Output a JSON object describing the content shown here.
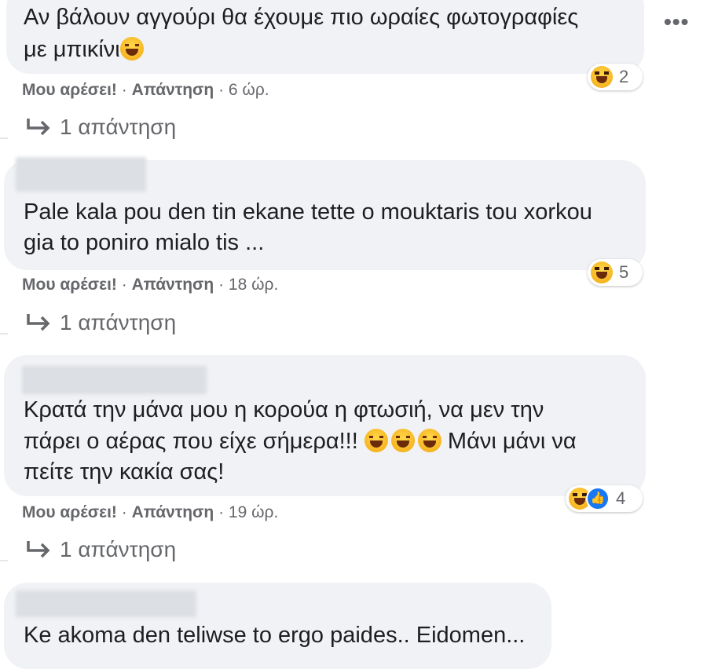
{
  "more_label": "•••",
  "comments": [
    {
      "lines": [
        "Αν βάλουν αγγούρι θα έχουμε πιο ωραίες φωτογραφίες",
        "με μπικίνι"
      ],
      "inline_emoji_count": 1,
      "reaction_count": "2",
      "reactions": [
        "haha-icon"
      ],
      "like_label": "Μου αρέσει!",
      "reply_label": "Απάντηση",
      "time": "6 ώρ.",
      "replies_label": "1 απάντηση"
    },
    {
      "lines": [
        "Pale kala pou den tin ekane tette o mouktaris tou xorkou",
        "gia to poniro mialo tis ..."
      ],
      "reaction_count": "5",
      "reactions": [
        "haha-icon"
      ],
      "like_label": "Μου αρέσει!",
      "reply_label": "Απάντηση",
      "time": "18 ώρ.",
      "replies_label": "1 απάντηση"
    },
    {
      "lines": [
        "Κρατά την μάνα μου η κορούα η φτωσιή, να μεν την",
        "πάρει ο αέρας που είχε σήμερα!!!",
        "Μάνι μάνι να",
        "πείτε την κακία σας!"
      ],
      "reaction_count": "4",
      "reactions": [
        "haha-icon",
        "like-icon"
      ],
      "like_label": "Μου αρέσει!",
      "reply_label": "Απάντηση",
      "time": "19 ώρ.",
      "replies_label": "1 απάντηση"
    },
    {
      "lines": [
        "Ke akoma den teliwse to ergo paides.. Eidomen..."
      ]
    }
  ],
  "colors": {
    "bubble": "#f0f2f5",
    "meta": "#65676b",
    "like_blue": "#1877f2",
    "haha_yellow": "#f7b521"
  }
}
